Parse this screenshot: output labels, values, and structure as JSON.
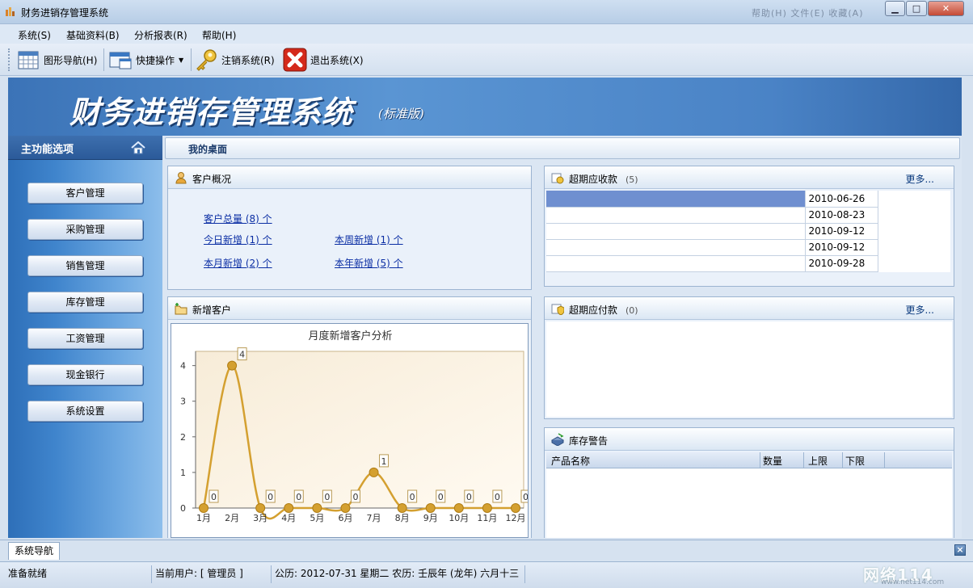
{
  "window": {
    "title": "财务进销存管理系统",
    "blurred_menu": "帮助(H)  文件(E)  收藏(A)",
    "controls": {
      "minimize": "▁",
      "maximize": "□",
      "close": "✕"
    }
  },
  "menu": [
    "系统(S)",
    "基础资料(B)",
    "分析报表(R)",
    "帮助(H)"
  ],
  "toolbar": {
    "graph_nav": "图形导航(H)",
    "quick_ops": "快捷操作",
    "logout": "注销系统(R)",
    "exit": "退出系统(X)"
  },
  "banner": {
    "title": "财务进销存管理系统",
    "subtitle": "(标准版)"
  },
  "sidebar": {
    "title": "主功能选项",
    "items": [
      "客户管理",
      "采购管理",
      "销售管理",
      "库存管理",
      "工资管理",
      "现金银行",
      "系统设置"
    ]
  },
  "desktop_tab": "我的桌面",
  "customer_overview": {
    "title": "客户概况",
    "total": "客户总量 (8) 个",
    "today": "今日新增 (1) 个",
    "week": "本周新增 (1) 个",
    "month": "本月新增 (2) 个",
    "year": "本年新增 (5) 个"
  },
  "new_customers": {
    "title": "新增客户"
  },
  "receivables": {
    "title": "超期应收款",
    "count": "(5)",
    "more": "更多...",
    "dates": [
      "2010-06-26",
      "2010-08-23",
      "2010-09-12",
      "2010-09-12",
      "2010-09-28"
    ]
  },
  "payables": {
    "title": "超期应付款",
    "count": "(0)",
    "more": "更多..."
  },
  "stock_alert": {
    "title": "库存警告",
    "columns": [
      "产品名称",
      "数量",
      "上限",
      "下限"
    ]
  },
  "bottom": {
    "tab": "系统导航",
    "close": "×"
  },
  "status": {
    "ready": "准备就绪",
    "user": "当前用户: [ 管理员 ]",
    "date": "公历: 2012-07-31 星期二  农历: 壬辰年 (龙年) 六月十三"
  },
  "watermark": {
    "text": "网络114",
    "url": "www.net114.com"
  },
  "chart_data": {
    "type": "line",
    "title": "月度新增客户分析",
    "categories": [
      "1月",
      "2月",
      "3月",
      "4月",
      "5月",
      "6月",
      "7月",
      "8月",
      "9月",
      "10月",
      "11月",
      "12月"
    ],
    "values": [
      0,
      4,
      0,
      0,
      0,
      0,
      1,
      0,
      0,
      0,
      0,
      0
    ],
    "yticks": [
      "0",
      "1",
      "2",
      "3",
      "4"
    ],
    "ylim": [
      0,
      4.4
    ],
    "line_color": "#d4a030",
    "plot_bg": "#f7ecd8",
    "smooth": true,
    "data_labels": true
  }
}
